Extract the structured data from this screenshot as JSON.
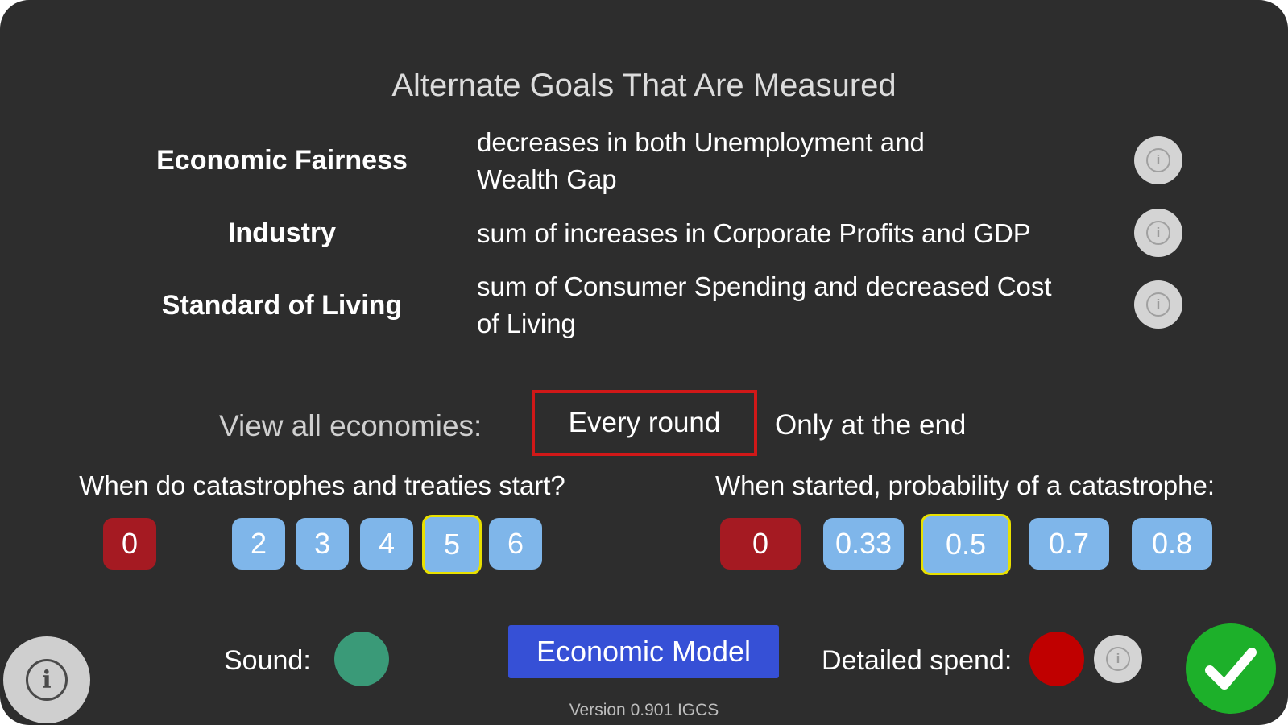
{
  "title": "Alternate Goals That Are Measured",
  "goals": [
    {
      "name": "Economic Fairness",
      "desc_line1": "decreases in both Unemployment and",
      "desc_line2": "Wealth Gap"
    },
    {
      "name": "Industry",
      "desc_line1": "sum of increases in Corporate Profits and GDP",
      "desc_line2": ""
    },
    {
      "name": "Standard of Living",
      "desc_line1": "sum of Consumer Spending and decreased Cost",
      "desc_line2": "of Living"
    }
  ],
  "info_icon_glyph": "i",
  "view": {
    "label": "View all economies:",
    "options": [
      "Every round",
      "Only at the end"
    ],
    "selected": "Every round"
  },
  "start": {
    "question": "When do catastrophes and treaties start?",
    "options": [
      "0",
      "2",
      "3",
      "4",
      "5",
      "6"
    ],
    "selected": "5"
  },
  "probability": {
    "question": "When started, probability of a catastrophe:",
    "options": [
      "0",
      "0.33",
      "0.5",
      "0.7",
      "0.8"
    ],
    "selected": "0.5"
  },
  "sound": {
    "label": "Sound:",
    "color": "#3a9a78"
  },
  "economic_model": {
    "label": "Economic Model"
  },
  "detailed_spend": {
    "label": "Detailed spend:",
    "color": "#c00000"
  },
  "version": "Version 0.901 IGCS",
  "colors": {
    "background": "#2d2d2d",
    "chip": "#7fb6ea",
    "chip_zero": "#a51a22",
    "selected_outline": "#e8e000",
    "view_selected_outline": "#d01818",
    "button_blue": "#3650d6",
    "confirm_green": "#1db02a"
  }
}
